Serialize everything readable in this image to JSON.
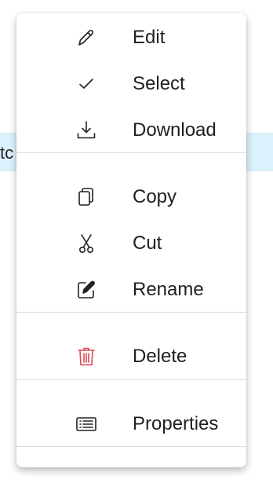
{
  "background": {
    "row_text": "tc",
    "row_color": "#dbf1fb"
  },
  "menu": {
    "groups": [
      {
        "items": [
          {
            "label": "Edit",
            "icon": "pencil-icon"
          },
          {
            "label": "Select",
            "icon": "checkmark-icon"
          },
          {
            "label": "Download",
            "icon": "download-icon"
          }
        ]
      },
      {
        "items": [
          {
            "label": "Copy",
            "icon": "copy-icon"
          },
          {
            "label": "Cut",
            "icon": "scissors-icon"
          },
          {
            "label": "Rename",
            "icon": "rename-icon"
          }
        ]
      },
      {
        "items": [
          {
            "label": "Delete",
            "icon": "trash-icon",
            "icon_color": "#d94b55"
          }
        ]
      },
      {
        "items": [
          {
            "label": "Properties",
            "icon": "properties-icon"
          }
        ]
      }
    ]
  }
}
